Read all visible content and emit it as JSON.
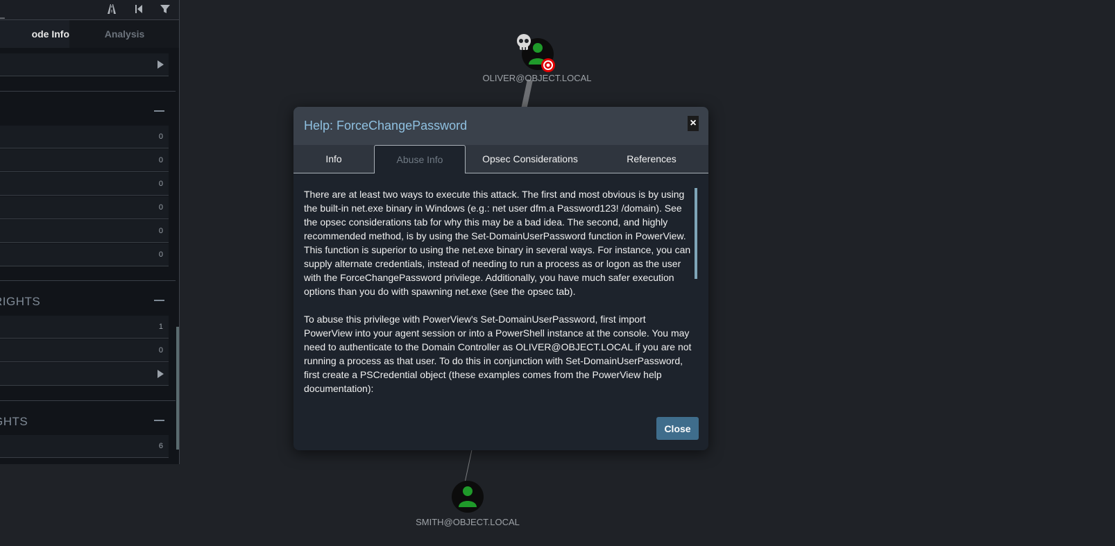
{
  "left_panel": {
    "tabs": {
      "node_info": "ode Info",
      "analysis": "Analysis"
    },
    "rows_top": [
      {
        "count": "0"
      },
      {
        "count": "0"
      },
      {
        "count": "0"
      },
      {
        "count": "0"
      },
      {
        "count": "0"
      },
      {
        "count": "0"
      }
    ],
    "section_rights_1": {
      "title": "RIGHTS"
    },
    "rows_rights_1": [
      {
        "count": "1"
      },
      {
        "count": "0"
      }
    ],
    "section_rights_2": {
      "title": "GHTS"
    },
    "rows_rights_2": [
      {
        "count": "6"
      }
    ]
  },
  "graph": {
    "nodes": {
      "oliver": {
        "label": "OLIVER@OBJECT.LOCAL"
      },
      "smith": {
        "label": "SMITH@OBJECT.LOCAL"
      }
    }
  },
  "modal": {
    "title": "Help: ForceChangePassword",
    "close_x": "×",
    "tabs": [
      "Info",
      "Abuse Info",
      "Opsec Considerations",
      "References"
    ],
    "active_tab": "Abuse Info",
    "paragraphs": [
      "There are at least two ways to execute this attack. The first and most obvious is by using the built-in net.exe binary in Windows (e.g.: net user dfm.a Password123! /domain). See the opsec considerations tab for why this may be a bad idea. The second, and highly recommended method, is by using the Set-DomainUserPassword function in PowerView. This function is superior to using the net.exe binary in several ways. For instance, you can supply alternate credentials, instead of needing to run a process as or logon as the user with the ForceChangePassword privilege. Additionally, you have much safer execution options than you do with spawning net.exe (see the opsec tab).",
      "To abuse this privilege with PowerView's Set-DomainUserPassword, first import PowerView into your agent session or into a PowerShell instance at the console. You may need to authenticate to the Domain Controller as OLIVER@OBJECT.LOCAL if you are not running a process as that user. To do this in conjunction with Set-DomainUserPassword, first create a PSCredential object (these examples comes from the PowerView help documentation):"
    ],
    "close_button": "Close"
  }
}
